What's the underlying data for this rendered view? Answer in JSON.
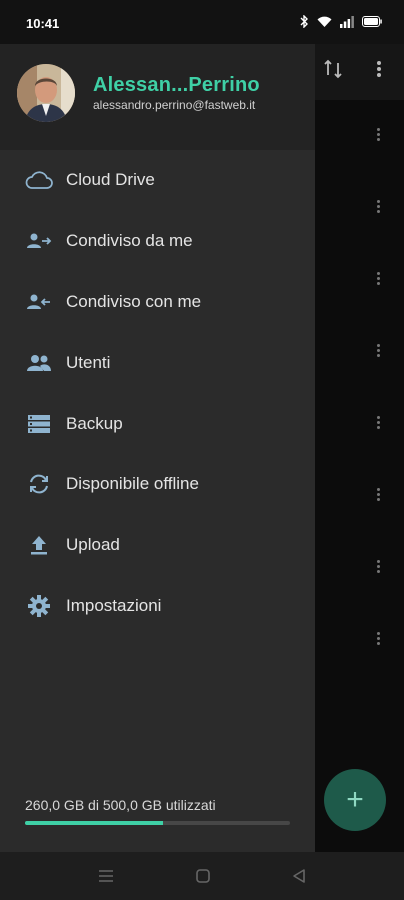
{
  "status_bar": {
    "time": "10:41",
    "icons": [
      "bluetooth-icon",
      "wifi-icon",
      "signal-icon",
      "battery-icon"
    ]
  },
  "drawer": {
    "user": {
      "name": "Alessan...Perrino",
      "email": "alessandro.perrino@fastweb.it",
      "avatar": "avatar-photo"
    },
    "menu": [
      {
        "label": "Cloud Drive",
        "icon": "cloud-icon"
      },
      {
        "label": "Condiviso da me",
        "icon": "shared-by-me-icon"
      },
      {
        "label": "Condiviso con me",
        "icon": "shared-with-me-icon"
      },
      {
        "label": "Utenti",
        "icon": "users-icon"
      },
      {
        "label": "Backup",
        "icon": "backup-icon"
      },
      {
        "label": "Disponibile offline",
        "icon": "sync-icon"
      },
      {
        "label": "Upload",
        "icon": "upload-icon"
      },
      {
        "label": "Impostazioni",
        "icon": "settings-icon"
      }
    ],
    "storage": {
      "text": "260,0 GB di 500,0 GB utilizzati",
      "used_fraction": 0.52
    }
  },
  "colors": {
    "accent": "#3fd0a6",
    "drawer_bg": "#2b2b2b",
    "header_bg": "#232323",
    "icon": "#8fb4cf"
  },
  "background_app": {
    "toolbar_icons": [
      "sort-icon",
      "more-vert-icon"
    ],
    "fab_icon": "plus-icon"
  },
  "nav_bar": {
    "buttons": [
      "recents-icon",
      "home-icon",
      "back-icon"
    ]
  }
}
